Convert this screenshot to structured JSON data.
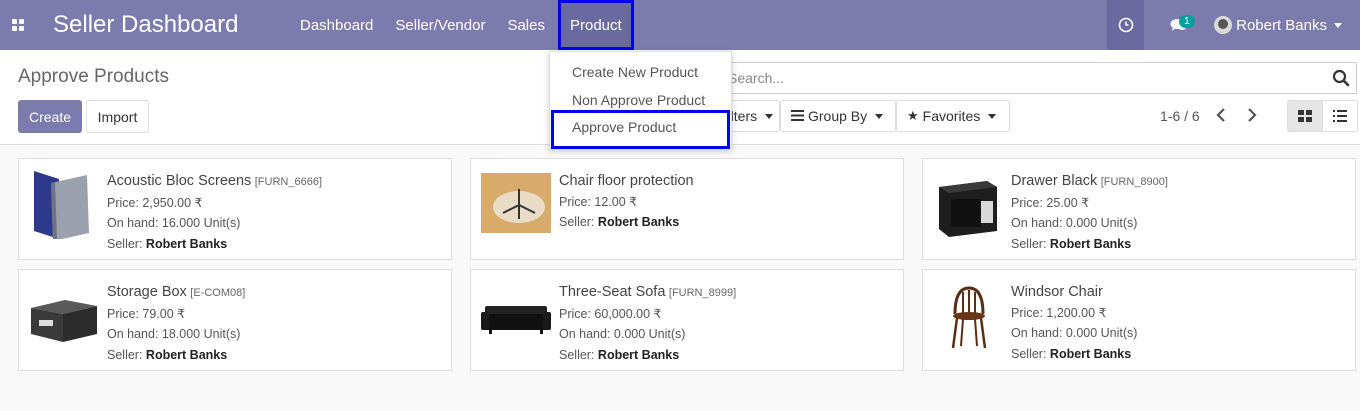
{
  "navbar": {
    "brand": "Seller Dashboard",
    "menu": [
      "Dashboard",
      "Seller/Vendor",
      "Sales",
      "Product"
    ],
    "badge_count": "1",
    "user_name": "Robert Banks",
    "color": "#7c7bad"
  },
  "control": {
    "title": "Approve Products",
    "create_label": "Create",
    "import_label": "Import",
    "search_placeholder": "Search...",
    "filters_label": "Filters",
    "groupby_label": "Group By",
    "favorites_label": "Favorites",
    "pager": "1-6 / 6"
  },
  "dropdown": {
    "items": [
      "Create New Product",
      "Non Approve Product",
      "Approve Product"
    ]
  },
  "products": [
    {
      "name": "Acoustic Bloc Screens",
      "ref": "[FURN_6666]",
      "price": "Price: 2,950.00 ₹",
      "onhand": "On hand: 16.000 Unit(s)",
      "seller_label": "Seller:",
      "seller": "Robert Banks"
    },
    {
      "name": "Chair floor protection",
      "ref": "",
      "price": "Price: 12.00 ₹",
      "onhand": "",
      "seller_label": "Seller:",
      "seller": "Robert Banks"
    },
    {
      "name": "Drawer Black",
      "ref": "[FURN_8900]",
      "price": "Price: 25.00 ₹",
      "onhand": "On hand: 0.000 Unit(s)",
      "seller_label": "Seller:",
      "seller": "Robert Banks"
    },
    {
      "name": "Storage Box",
      "ref": "[E-COM08]",
      "price": "Price: 79.00 ₹",
      "onhand": "On hand: 18.000 Unit(s)",
      "seller_label": "Seller:",
      "seller": "Robert Banks"
    },
    {
      "name": "Three-Seat Sofa",
      "ref": "[FURN_8999]",
      "price": "Price: 60,000.00 ₹",
      "onhand": "On hand: 0.000 Unit(s)",
      "seller_label": "Seller:",
      "seller": "Robert Banks"
    },
    {
      "name": "Windsor Chair",
      "ref": "",
      "price": "Price: 1,200.00 ₹",
      "onhand": "On hand: 0.000 Unit(s)",
      "seller_label": "Seller:",
      "seller": "Robert Banks"
    }
  ]
}
